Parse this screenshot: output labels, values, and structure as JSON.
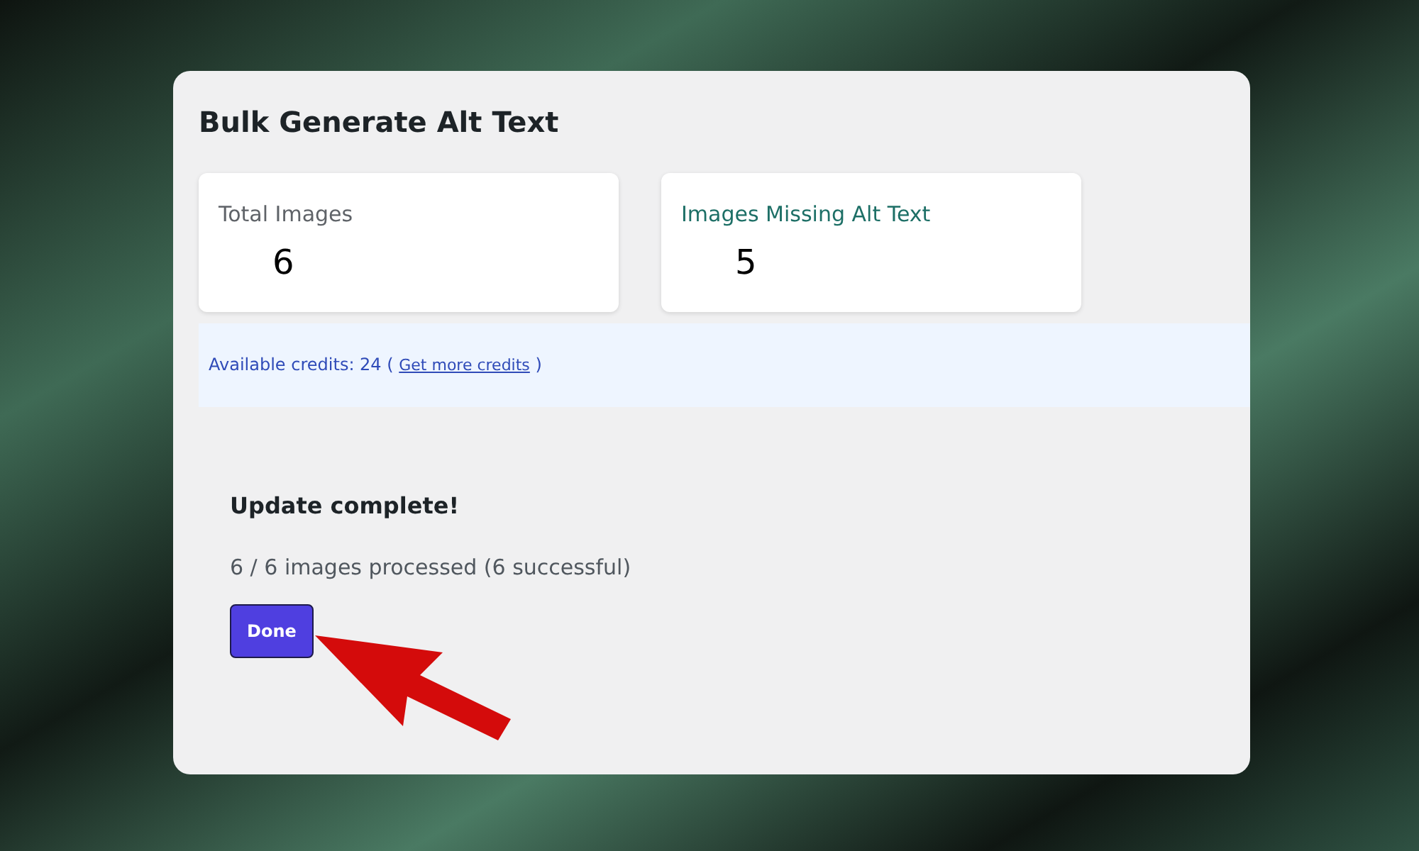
{
  "title": "Bulk Generate Alt Text",
  "stats": [
    {
      "label": "Total Images",
      "value": "6",
      "kind": "neutral"
    },
    {
      "label": "Images Missing Alt Text",
      "value": "5",
      "kind": "accent"
    }
  ],
  "credits": {
    "text": "Available credits: 24 (",
    "link": "Get more credits",
    "close": ")"
  },
  "result": {
    "heading": "Update complete!",
    "progress": "6 / 6 images processed (6 successful)",
    "button": "Done"
  }
}
